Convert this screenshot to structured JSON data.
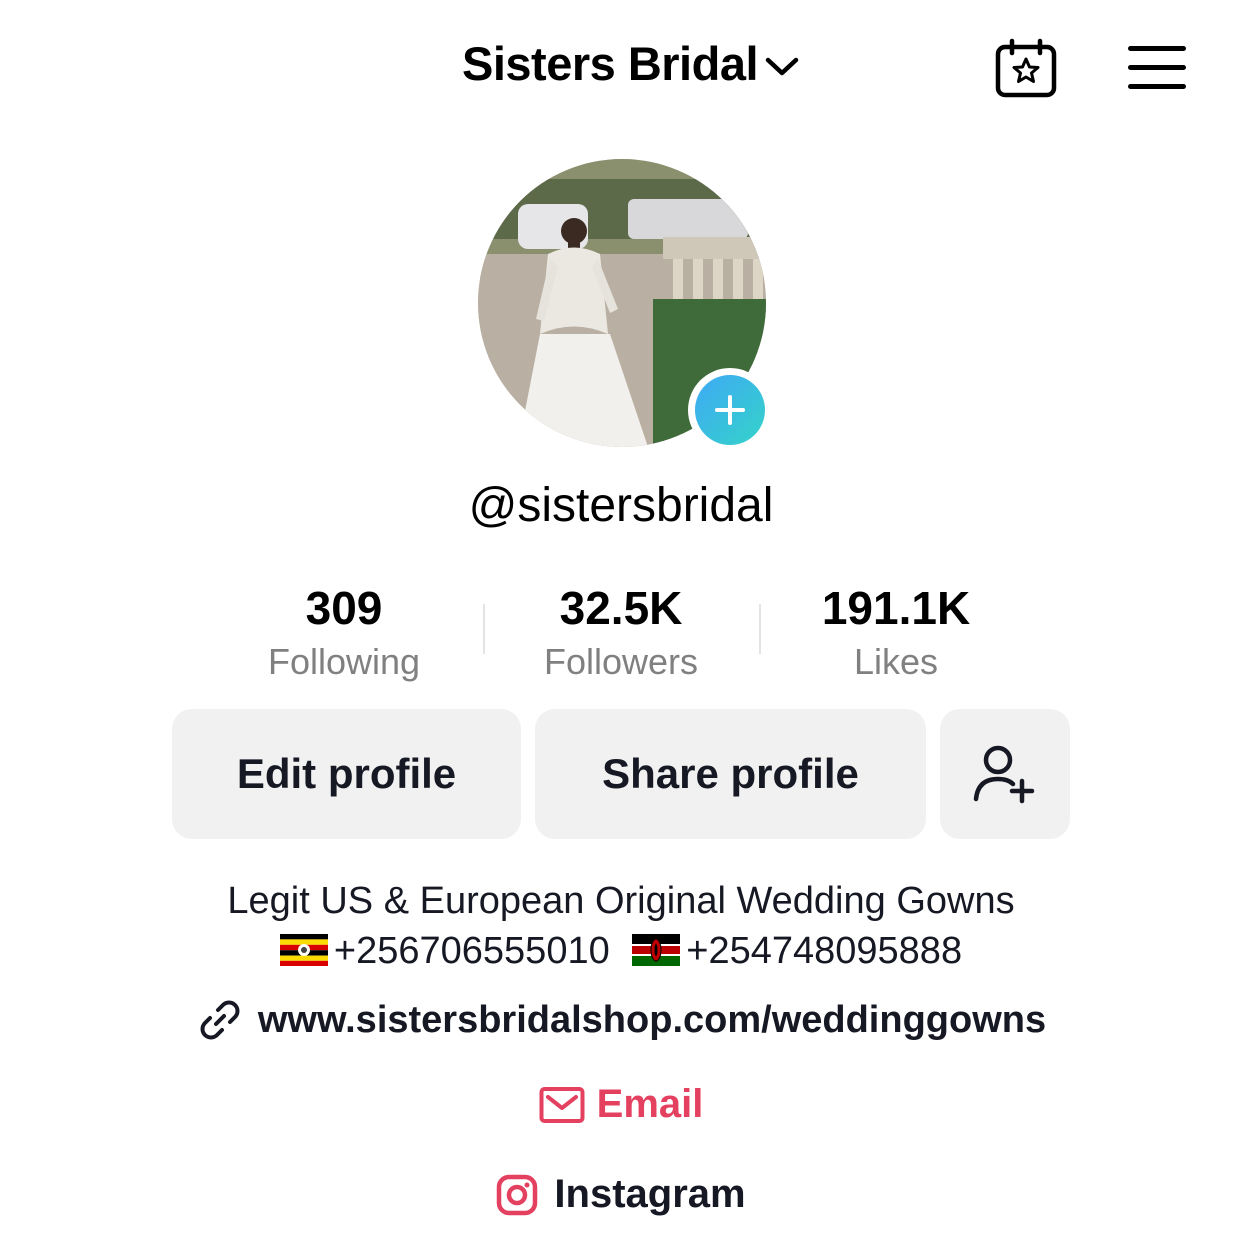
{
  "header": {
    "account_name": "Sisters Bridal",
    "icons": [
      "chevron-down-icon",
      "calendar-star-icon",
      "hamburger-menu-icon"
    ]
  },
  "profile": {
    "username": "@sistersbridal",
    "add_photo_icon": "plus-icon"
  },
  "stats": [
    {
      "value": "309",
      "label": "Following"
    },
    {
      "value": "32.5K",
      "label": "Followers"
    },
    {
      "value": "191.1K",
      "label": "Likes"
    }
  ],
  "actions": {
    "edit_label": "Edit profile",
    "share_label": "Share profile",
    "add_friend_icon": "add-user-icon"
  },
  "bio": {
    "line1": "Legit US & European Original Wedding Gowns",
    "phone_ug": "+256706555010",
    "phone_ke": "+254748095888",
    "flag_ug": "uganda-flag",
    "flag_ke": "kenya-flag"
  },
  "links": {
    "website": "www.sistersbridalshop.com/weddinggowns",
    "email": "Email",
    "instagram": "Instagram"
  },
  "colors": {
    "email_accent": "#e4405f",
    "instagram_accent": "#e4405f",
    "button_bg": "#f1f1f2",
    "secondary_text": "#808080"
  }
}
